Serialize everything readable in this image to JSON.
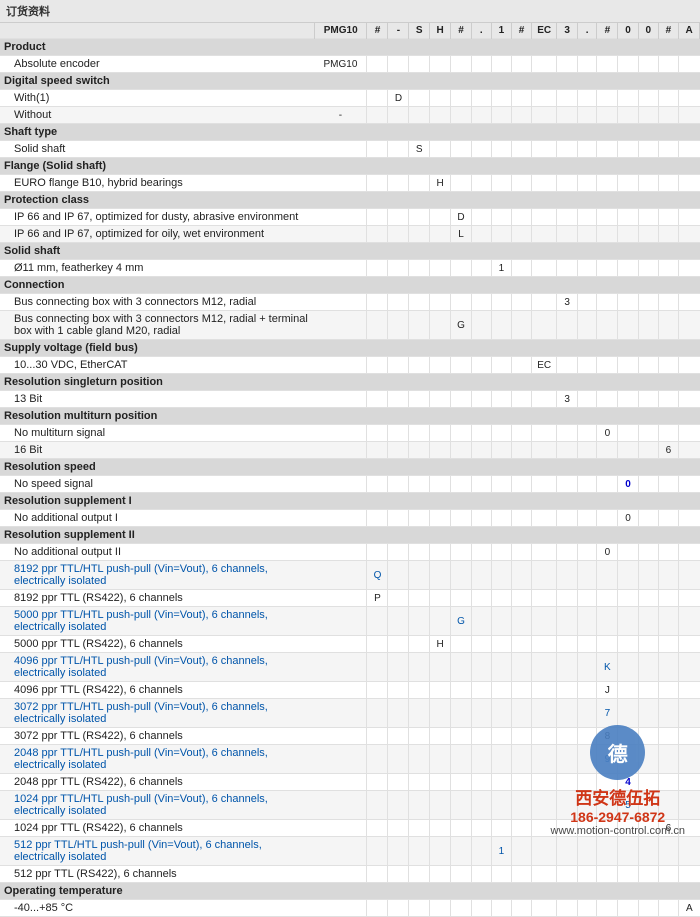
{
  "header": {
    "title": "订货资料",
    "columns": [
      "PMG10",
      "#",
      "-",
      "S",
      "H",
      "#",
      ".",
      "1",
      "#",
      "EC",
      "3",
      ".",
      "#",
      "0",
      "0",
      "#",
      "A"
    ]
  },
  "sections": [
    {
      "type": "section",
      "label": "Product"
    },
    {
      "type": "item",
      "label": "Absolute encoder",
      "value": "PMG10",
      "code": ""
    },
    {
      "type": "section",
      "label": "Digital speed switch"
    },
    {
      "type": "item",
      "label": "With(1)",
      "value": "",
      "code": "D"
    },
    {
      "type": "item",
      "label": "Without",
      "value": "-",
      "code": ""
    },
    {
      "type": "section",
      "label": "Shaft type"
    },
    {
      "type": "item",
      "label": "Solid shaft",
      "value": "",
      "code": "S"
    },
    {
      "type": "section",
      "label": "Flange (Solid shaft)"
    },
    {
      "type": "item",
      "label": "EURO flange B10, hybrid bearings",
      "value": "",
      "code": "H"
    },
    {
      "type": "section",
      "label": "Protection class"
    },
    {
      "type": "item",
      "label": "IP 66 and IP 67, optimized for dusty, abrasive environment",
      "value": "",
      "code": "D"
    },
    {
      "type": "item",
      "label": "IP 66 and IP 67, optimized for oily, wet environment",
      "value": "",
      "code": "L"
    },
    {
      "type": "section",
      "label": "Solid shaft"
    },
    {
      "type": "item",
      "label": "Ø11 mm, featherkey 4 mm",
      "value": "",
      "code": "1"
    },
    {
      "type": "section",
      "label": "Connection"
    },
    {
      "type": "item",
      "label": "Bus connecting box with 3 connectors M12, radial",
      "value": "",
      "code": "3"
    },
    {
      "type": "item",
      "label": "Bus connecting box with 3 connectors M12, radial + terminal box with 1 cable gland M20, radial",
      "value": "",
      "code": "G"
    },
    {
      "type": "section",
      "label": "Supply voltage (field bus)"
    },
    {
      "type": "item",
      "label": "10...30 VDC, EtherCAT",
      "value": "",
      "code": "EC"
    },
    {
      "type": "section",
      "label": "Resolution singleturn position"
    },
    {
      "type": "item",
      "label": "13 Bit",
      "value": "",
      "code": "3"
    },
    {
      "type": "section",
      "label": "Resolution multiturn position"
    },
    {
      "type": "item",
      "label": "No multiturn signal",
      "value": "",
      "code": "0"
    },
    {
      "type": "item",
      "label": "16 Bit",
      "value": "",
      "code": "6"
    },
    {
      "type": "section",
      "label": "Resolution speed"
    },
    {
      "type": "item",
      "label": "No speed signal",
      "value": "",
      "code": "0",
      "highlight": true
    },
    {
      "type": "section",
      "label": "Resolution supplement I"
    },
    {
      "type": "item",
      "label": "No additional output I",
      "value": "",
      "code": "0"
    },
    {
      "type": "section",
      "label": "Resolution supplement II"
    },
    {
      "type": "item",
      "label": "No additional output II",
      "value": "",
      "code": "0"
    },
    {
      "type": "item",
      "label": "8192 ppr TTL/HTL push-pull (Vin=Vout), 6 channels, electrically isolated",
      "value": "",
      "code": "Q",
      "bold": true
    },
    {
      "type": "item",
      "label": "8192 ppr TTL (RS422), 6 channels",
      "value": "",
      "code": "P"
    },
    {
      "type": "item",
      "label": "5000 ppr TTL/HTL push-pull (Vin=Vout), 6 channels, electrically isolated",
      "value": "",
      "code": "G",
      "bold": true
    },
    {
      "type": "item",
      "label": "5000 ppr TTL (RS422), 6 channels",
      "value": "",
      "code": "H"
    },
    {
      "type": "item",
      "label": "4096 ppr TTL/HTL push-pull (Vin=Vout), 6 channels, electrically isolated",
      "value": "",
      "code": "K",
      "bold": true
    },
    {
      "type": "item",
      "label": "4096 ppr TTL (RS422), 6 channels",
      "value": "",
      "code": "J"
    },
    {
      "type": "item",
      "label": "3072 ppr TTL/HTL push-pull (Vin=Vout), 6 channels, electrically isolated",
      "value": "",
      "code": "7",
      "bold": true
    },
    {
      "type": "item",
      "label": "3072 ppr TTL (RS422), 6 channels",
      "value": "",
      "code": "8"
    },
    {
      "type": "item",
      "label": "2048 ppr TTL/HTL push-pull (Vin=Vout), 6 channels, electrically isolated",
      "value": "",
      "code": "9",
      "bold": true
    },
    {
      "type": "item",
      "label": "2048 ppr TTL (RS422), 6 channels",
      "value": "",
      "code": "4",
      "highlight": true
    },
    {
      "type": "item",
      "label": "1024 ppr TTL/HTL push-pull (Vin=Vout), 6 channels, electrically isolated",
      "value": "",
      "code": "5",
      "bold": true
    },
    {
      "type": "item",
      "label": "1024 ppr TTL (RS422), 6 channels",
      "value": "",
      "code": "6"
    },
    {
      "type": "item",
      "label": "512 ppr TTL/HTL push-pull (Vin=Vout), 6 channels, electrically isolated",
      "value": "",
      "code": "1",
      "bold": true
    },
    {
      "type": "item",
      "label": "512 ppr TTL (RS422), 6 channels",
      "value": "",
      "code": ""
    },
    {
      "type": "section",
      "label": "Operating temperature"
    },
    {
      "type": "item",
      "label": "-40...+85 °C",
      "value": "",
      "code": "A"
    }
  ],
  "watermark": {
    "logo_char": "德",
    "name": "西安德伍拓",
    "phone": "186-2947-6872",
    "website": "www.motion-control.com.cn"
  }
}
